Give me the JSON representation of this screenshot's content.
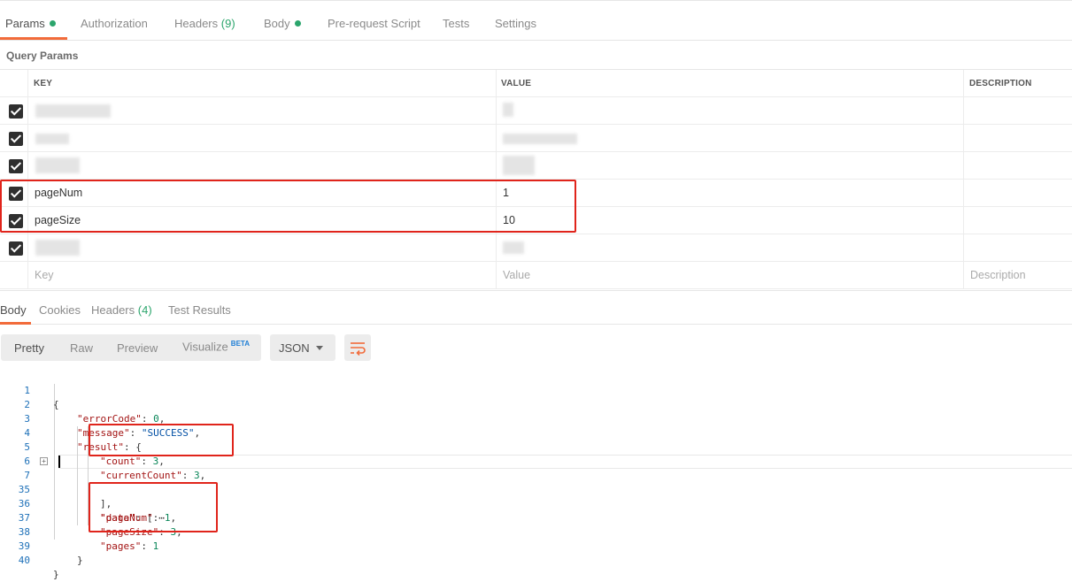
{
  "request_tabs": [
    {
      "label": "Params",
      "active": true,
      "dot": true
    },
    {
      "label": "Authorization"
    },
    {
      "label": "Headers",
      "count": "(9)"
    },
    {
      "label": "Body",
      "dot": true
    },
    {
      "label": "Pre-request Script"
    },
    {
      "label": "Tests"
    },
    {
      "label": "Settings"
    }
  ],
  "query_params": {
    "title": "Query Params",
    "columns": {
      "key": "KEY",
      "value": "VALUE",
      "description": "DESCRIPTION"
    },
    "rows": [
      {
        "key": "",
        "value": "",
        "checked": true,
        "redacted": true
      },
      {
        "key": "",
        "value": "",
        "checked": true,
        "redacted": true
      },
      {
        "key": "",
        "value": "",
        "checked": true,
        "redacted": true
      },
      {
        "key": "pageNum",
        "value": "1",
        "checked": true
      },
      {
        "key": "pageSize",
        "value": "10",
        "checked": true
      },
      {
        "key": "",
        "value": "",
        "checked": true,
        "redacted": true
      }
    ],
    "placeholders": {
      "key": "Key",
      "value": "Value",
      "description": "Description"
    }
  },
  "response_tabs": [
    {
      "label": "Body",
      "active": true
    },
    {
      "label": "Cookies"
    },
    {
      "label": "Headers",
      "count": "(4)"
    },
    {
      "label": "Test Results"
    }
  ],
  "format_buttons": {
    "pretty": "Pretty",
    "raw": "Raw",
    "preview": "Preview",
    "visualize": "Visualize",
    "beta": "BETA"
  },
  "format_select": "JSON",
  "code_lines": [
    {
      "num": "1",
      "text": "{"
    },
    {
      "num": "2",
      "text": "\"errorCode\": 0,"
    },
    {
      "num": "3",
      "text": "\"message\": \"SUCCESS\","
    },
    {
      "num": "4",
      "text": "\"result\": {"
    },
    {
      "num": "5",
      "text": "\"count\": 3,"
    },
    {
      "num": "6",
      "text": "\"currentCount\": 3,"
    },
    {
      "num": "7",
      "text": "\"data\": [ ⋯"
    },
    {
      "num": "35",
      "text": "],"
    },
    {
      "num": "36",
      "text": "\"pageNum\": 1,"
    },
    {
      "num": "37",
      "text": "\"pageSize\": 3,"
    },
    {
      "num": "38",
      "text": "\"pages\": 1"
    },
    {
      "num": "39",
      "text": "}"
    },
    {
      "num": "40",
      "text": "}"
    }
  ],
  "colors": {
    "accent": "#f26b3a",
    "status_green": "#2ba56c",
    "highlight_red": "#e0241b",
    "line_number_blue": "#1d70b8",
    "json_key": "#a31515",
    "json_number": "#098658",
    "json_string": "#0451a5"
  }
}
